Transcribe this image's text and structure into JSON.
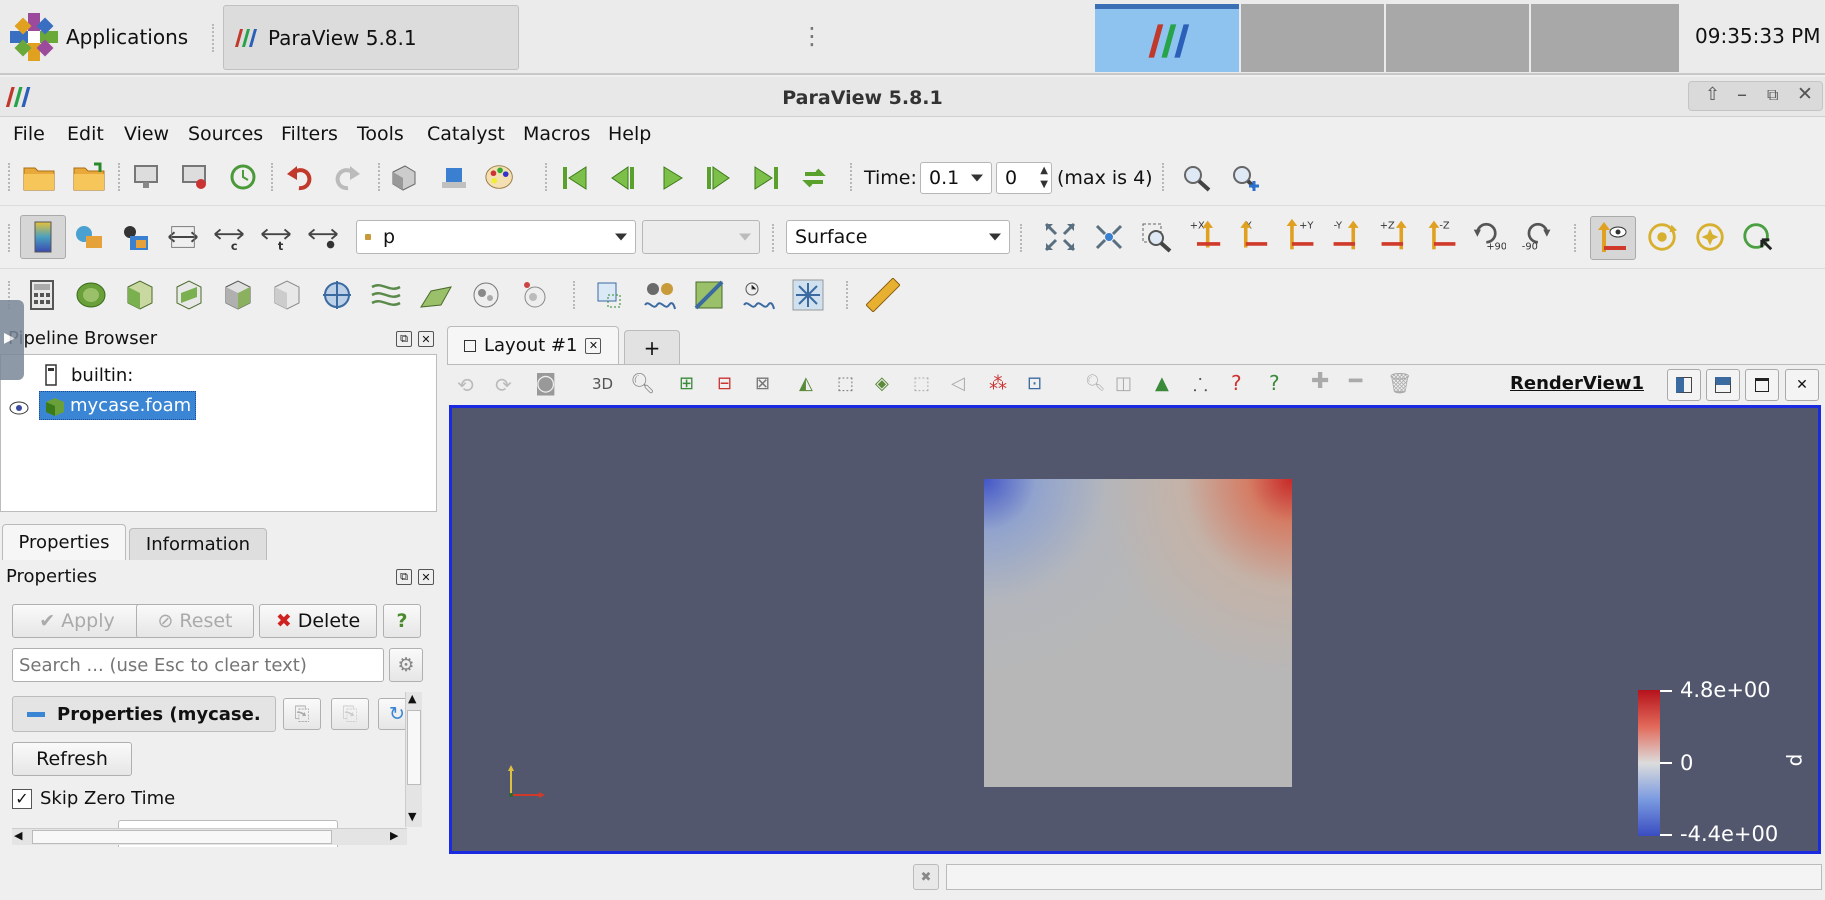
{
  "taskbar": {
    "applications_label": "Applications",
    "task_title": "ParaView 5.8.1",
    "clock": "09:35:33 PM"
  },
  "window": {
    "title": "ParaView 5.8.1"
  },
  "menu": [
    "File",
    "Edit",
    "View",
    "Sources",
    "Filters",
    "Tools",
    "Catalyst",
    "Macros",
    "Help"
  ],
  "time_toolbar": {
    "time_label": "Time:",
    "time_value": "0.1",
    "step_value": "0",
    "max_label": "(max is 4)"
  },
  "display_toolbar": {
    "color_array": "p",
    "component": "",
    "representation": "Surface",
    "camera_labels": [
      "+X",
      "-X",
      "+Y",
      "-Y",
      "+Z",
      "-Z",
      "+90",
      "-90"
    ]
  },
  "pipeline": {
    "title": "Pipeline Browser",
    "items": [
      {
        "label": "builtin:"
      },
      {
        "label": "mycase.foam"
      }
    ]
  },
  "properties": {
    "tabs": [
      "Properties",
      "Information"
    ],
    "title": "Properties",
    "apply_label": "Apply",
    "reset_label": "Reset",
    "delete_label": "Delete",
    "help_label": "?",
    "search_placeholder": "Search ... (use Esc to clear text)",
    "section_label": "Properties (mycase.",
    "refresh_label": "Refresh",
    "skip_zero_time_label": "Skip Zero Time",
    "skip_zero_time_checked": true
  },
  "layout": {
    "tab_label": "Layout #1",
    "add_tab": "+",
    "view_name": "RenderView1",
    "view_toolbar_3d": "3D"
  },
  "render": {
    "background": "#52576e",
    "colorbar": {
      "max_label": "4.8e+00",
      "mid_label": "0",
      "min_label": "-4.4e+00",
      "title": "p"
    }
  }
}
